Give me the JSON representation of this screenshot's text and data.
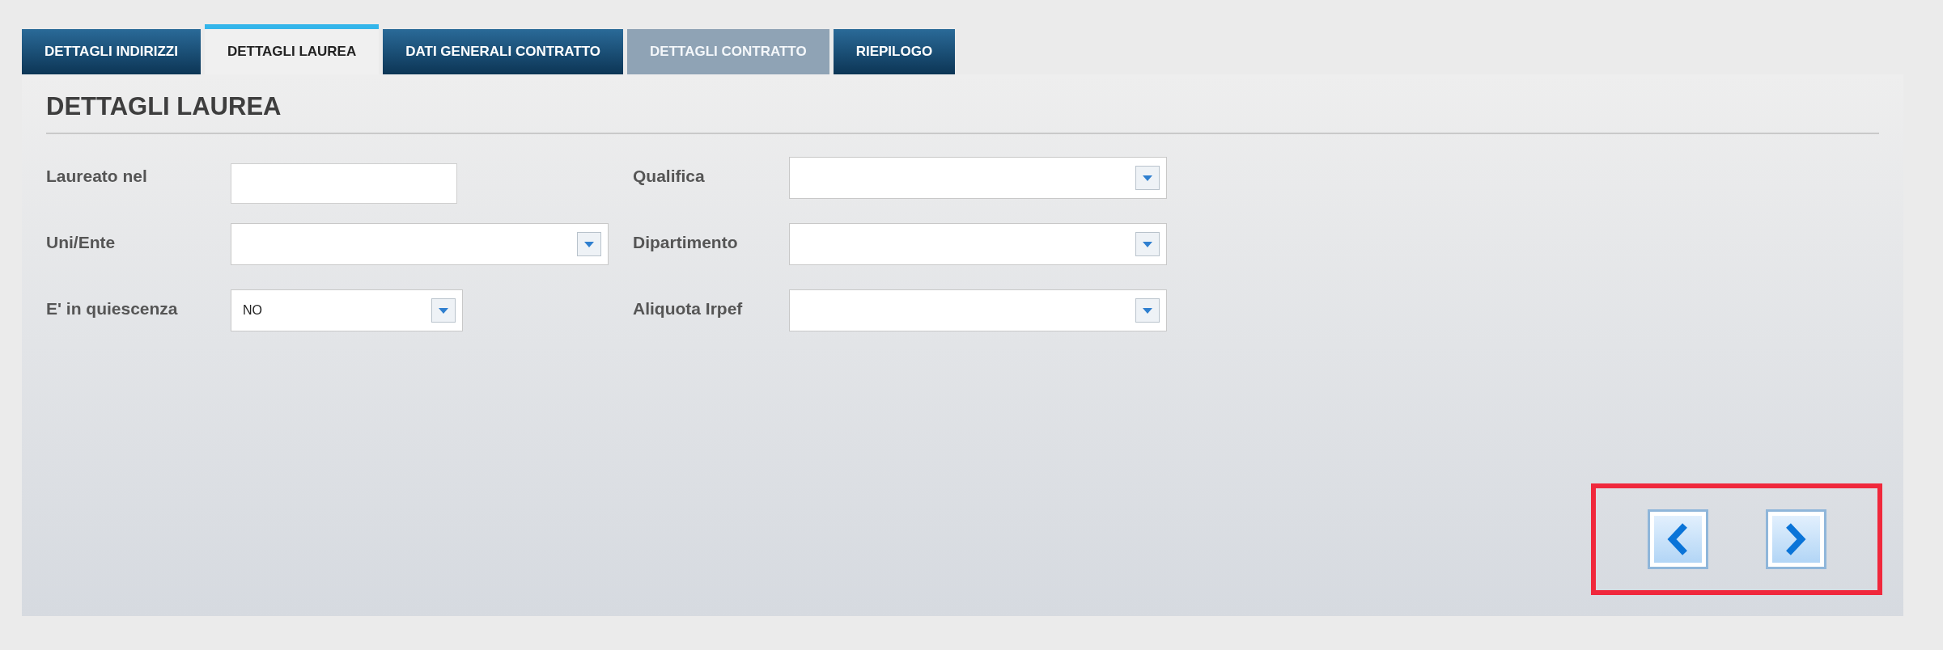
{
  "tabs": [
    {
      "label": "DETTAGLI INDIRIZZI",
      "selected": false,
      "disabled": false
    },
    {
      "label": "DETTAGLI LAUREA",
      "selected": true,
      "disabled": false
    },
    {
      "label": "DATI GENERALI CONTRATTO",
      "selected": false,
      "disabled": false
    },
    {
      "label": "DETTAGLI CONTRATTO",
      "selected": false,
      "disabled": true
    },
    {
      "label": "RIEPILOGO",
      "selected": false,
      "disabled": false
    }
  ],
  "heading": "DETTAGLI LAUREA",
  "left_fields": [
    {
      "label": "Laureato nel",
      "kind": "text"
    },
    {
      "label": "Uni/Ente",
      "kind": "select"
    },
    {
      "label": "E' in quiescenza",
      "kind": "select",
      "value": "NO"
    }
  ],
  "right_fields": [
    {
      "label": "Qualifica",
      "kind": "select"
    },
    {
      "label": "Dipartimento",
      "kind": "select"
    },
    {
      "label": "Aliquota Irpef",
      "kind": "select"
    }
  ],
  "nav": {
    "highlighted": true,
    "buttons": [
      {
        "kind": "prev"
      },
      {
        "kind": "next"
      }
    ]
  }
}
